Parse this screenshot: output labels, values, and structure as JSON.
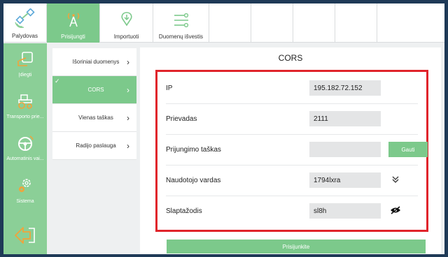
{
  "topbar": {
    "home_label": "Palydovas",
    "tabs": [
      {
        "label": "Prisijungti",
        "active": true,
        "icon": "antenna-icon"
      },
      {
        "label": "Importuoti",
        "active": false,
        "icon": "import-location-icon"
      },
      {
        "label": "Duomenų išvestis",
        "active": false,
        "icon": "data-output-icon"
      }
    ]
  },
  "sidebar": {
    "items": [
      {
        "label": "Įdiegti",
        "icon": "install-icon"
      },
      {
        "label": "Transporto prie...",
        "icon": "tractor-icon"
      },
      {
        "label": "Automatinis vai...",
        "icon": "steering-wheel-icon"
      },
      {
        "label": "Sistema",
        "icon": "settings-gear-icon"
      }
    ],
    "back_icon": "back-arrow-icon"
  },
  "submenu": {
    "items": [
      {
        "label": "Išoriniai duomenys",
        "active": false
      },
      {
        "label": "CORS",
        "active": true
      },
      {
        "label": "Vienas taškas",
        "active": false
      },
      {
        "label": "Radijo paslauga",
        "active": false
      }
    ]
  },
  "panel": {
    "title": "CORS",
    "fields": {
      "ip": {
        "label": "IP",
        "value": "195.182.72.152"
      },
      "port": {
        "label": "Prievadas",
        "value": "2111"
      },
      "mountpoint": {
        "label": "Prijungimo taškas",
        "value": "",
        "button": "Gauti"
      },
      "username": {
        "label": "Naudotojo vardas",
        "value": "1794lxra"
      },
      "password": {
        "label": "Slaptažodis",
        "value": "sl8h"
      }
    },
    "connect_label": "Prisijunkite"
  },
  "colors": {
    "accent": "#7cc98b",
    "sidebar": "#8bcf97",
    "highlight_border": "#e0242b"
  }
}
